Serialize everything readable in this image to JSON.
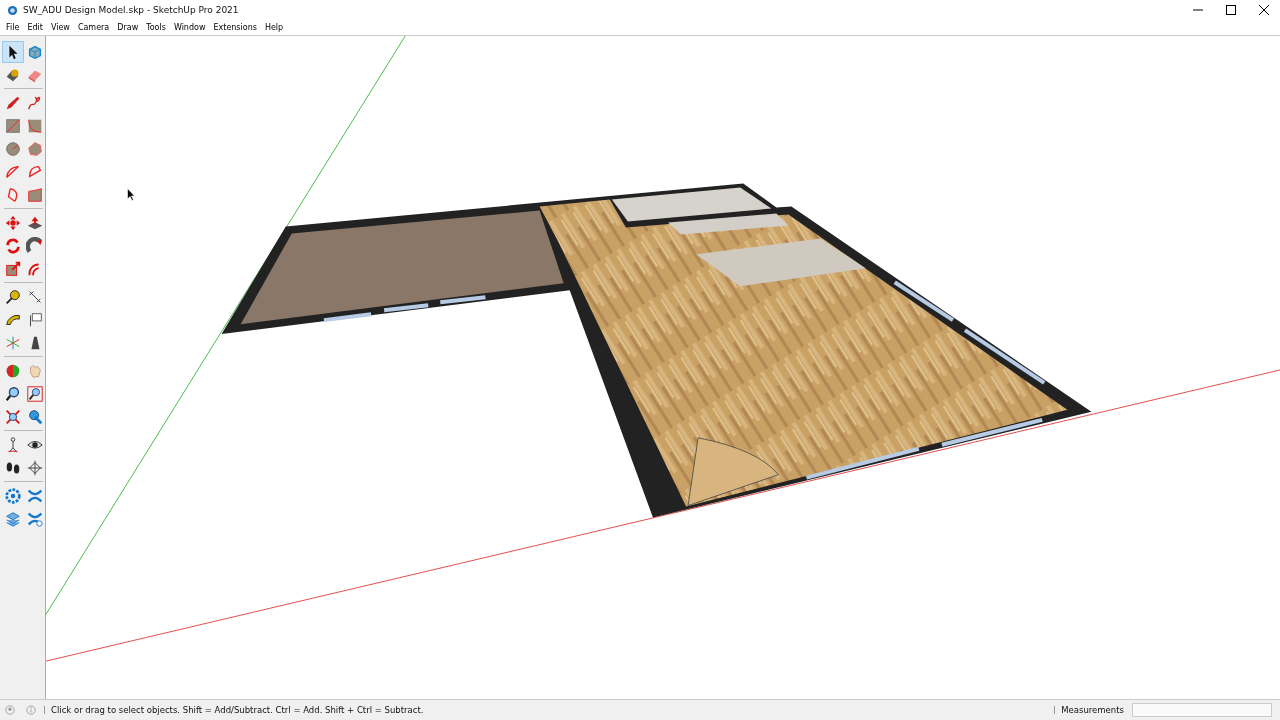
{
  "window": {
    "title": "SW_ADU Design Model.skp - SketchUp Pro 2021"
  },
  "menu": [
    "File",
    "Edit",
    "View",
    "Camera",
    "Draw",
    "Tools",
    "Window",
    "Extensions",
    "Help"
  ],
  "toolbar": {
    "groups": [
      {
        "tools": [
          {
            "selected": true
          },
          {
            "selected": false
          },
          {
            "selected": false
          },
          {
            "selected": false
          }
        ]
      },
      {
        "tools": [
          {
            "selected": false
          },
          {
            "selected": false
          },
          {
            "selected": false
          },
          {
            "selected": false
          },
          {
            "selected": false
          },
          {
            "selected": false
          },
          {
            "selected": false
          },
          {
            "selected": false
          },
          {
            "selected": false
          },
          {
            "selected": false
          }
        ]
      },
      {
        "tools": [
          {
            "selected": false
          },
          {
            "selected": false
          },
          {
            "selected": false
          },
          {
            "selected": false
          },
          {
            "selected": false
          },
          {
            "selected": false
          }
        ]
      },
      {
        "tools": [
          {
            "selected": false
          },
          {
            "selected": false
          },
          {
            "selected": false
          },
          {
            "selected": false
          },
          {
            "selected": false
          },
          {
            "selected": false
          }
        ]
      },
      {
        "tools": [
          {
            "selected": false
          },
          {
            "selected": false
          },
          {
            "selected": false
          },
          {
            "selected": false
          },
          {
            "selected": false
          },
          {
            "selected": false
          }
        ]
      },
      {
        "tools": [
          {
            "selected": false
          },
          {
            "selected": false
          },
          {
            "selected": false
          },
          {
            "selected": false
          }
        ]
      },
      {
        "tools": [
          {
            "selected": false
          },
          {
            "selected": false
          },
          {
            "selected": false
          },
          {
            "selected": false
          }
        ]
      }
    ]
  },
  "status_bar": {
    "hint": "Click or drag to select objects. Shift = Add/Subtract. Ctrl = Add. Shift + Ctrl = Subtract.",
    "measurements_label": "Measurements"
  }
}
